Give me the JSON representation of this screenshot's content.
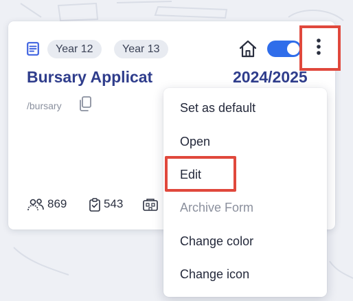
{
  "card": {
    "tags": [
      "Year 12",
      "Year 13"
    ],
    "title": "Bursary Applicat",
    "title_year": "2024/2025",
    "slug": "/bursary",
    "stats": {
      "users": "869",
      "submissions": "543"
    },
    "toggle": {
      "on": true,
      "color": "#2f6dea"
    }
  },
  "menu": {
    "items": [
      {
        "label": "Set as default"
      },
      {
        "label": "Open"
      },
      {
        "label": "Edit"
      },
      {
        "label": "Archive Form"
      },
      {
        "label": "Change color"
      },
      {
        "label": "Change icon"
      }
    ]
  },
  "colors": {
    "title": "#2f3d8c",
    "highlight": "#e0483c",
    "accent": "#2f6dea",
    "icon_blue": "#3f63e0"
  },
  "icons": {
    "form": "document-icon",
    "home": "home-icon",
    "more": "more-vertical-icon",
    "copy": "copy-icon",
    "users": "users-icon",
    "submissions": "clipboard-check-icon",
    "third": "building-icon"
  }
}
